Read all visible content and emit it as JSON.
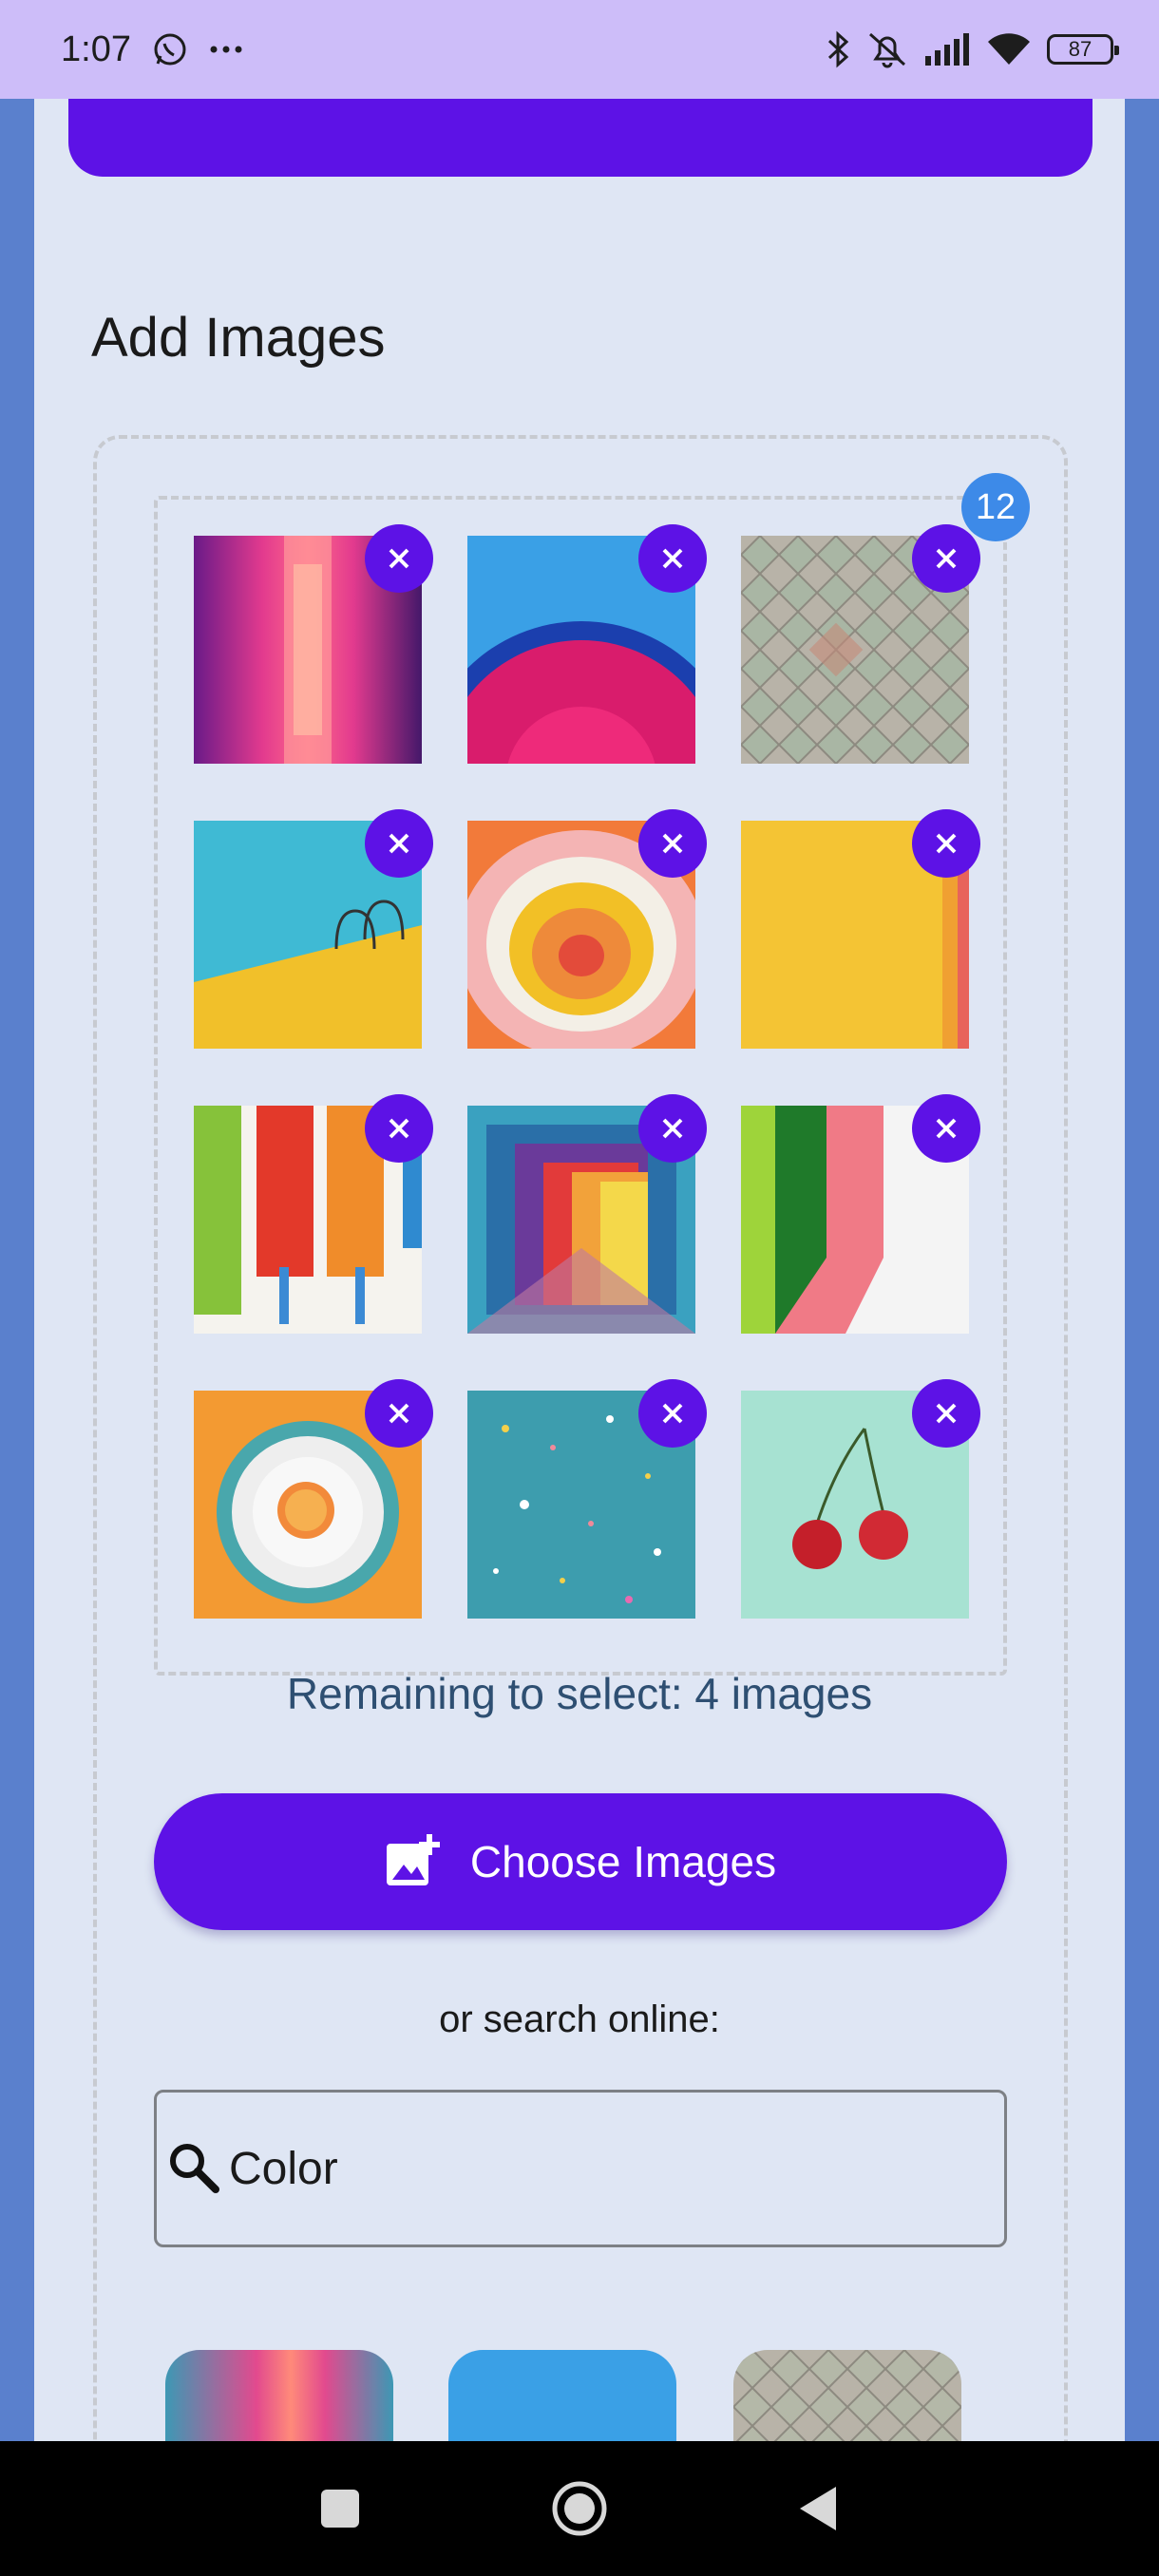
{
  "status_bar": {
    "time": "1:07",
    "battery": "87",
    "icons": [
      "whatsapp-icon",
      "more-icon",
      "bluetooth-icon",
      "mute-icon",
      "signal-icon",
      "wifi-icon",
      "battery-icon"
    ]
  },
  "section_title": "Add Images",
  "selected_count": "12",
  "remaining_text": "Remaining to select: 4 images",
  "choose_button": {
    "label": "Choose Images",
    "icon": "add-photo-icon"
  },
  "or_text": "or search online:",
  "search": {
    "value": "Color",
    "icon": "search-icon"
  },
  "remove_icon": "close-icon",
  "colors": {
    "accent": "#5d12e6",
    "badge": "#3d8ae8",
    "panel": "#dfe6f4",
    "page": "#5a80cd",
    "status_bar": "#cdbdf9"
  },
  "nav_bar": {
    "icons": [
      "recents-icon",
      "home-icon",
      "back-icon"
    ]
  }
}
